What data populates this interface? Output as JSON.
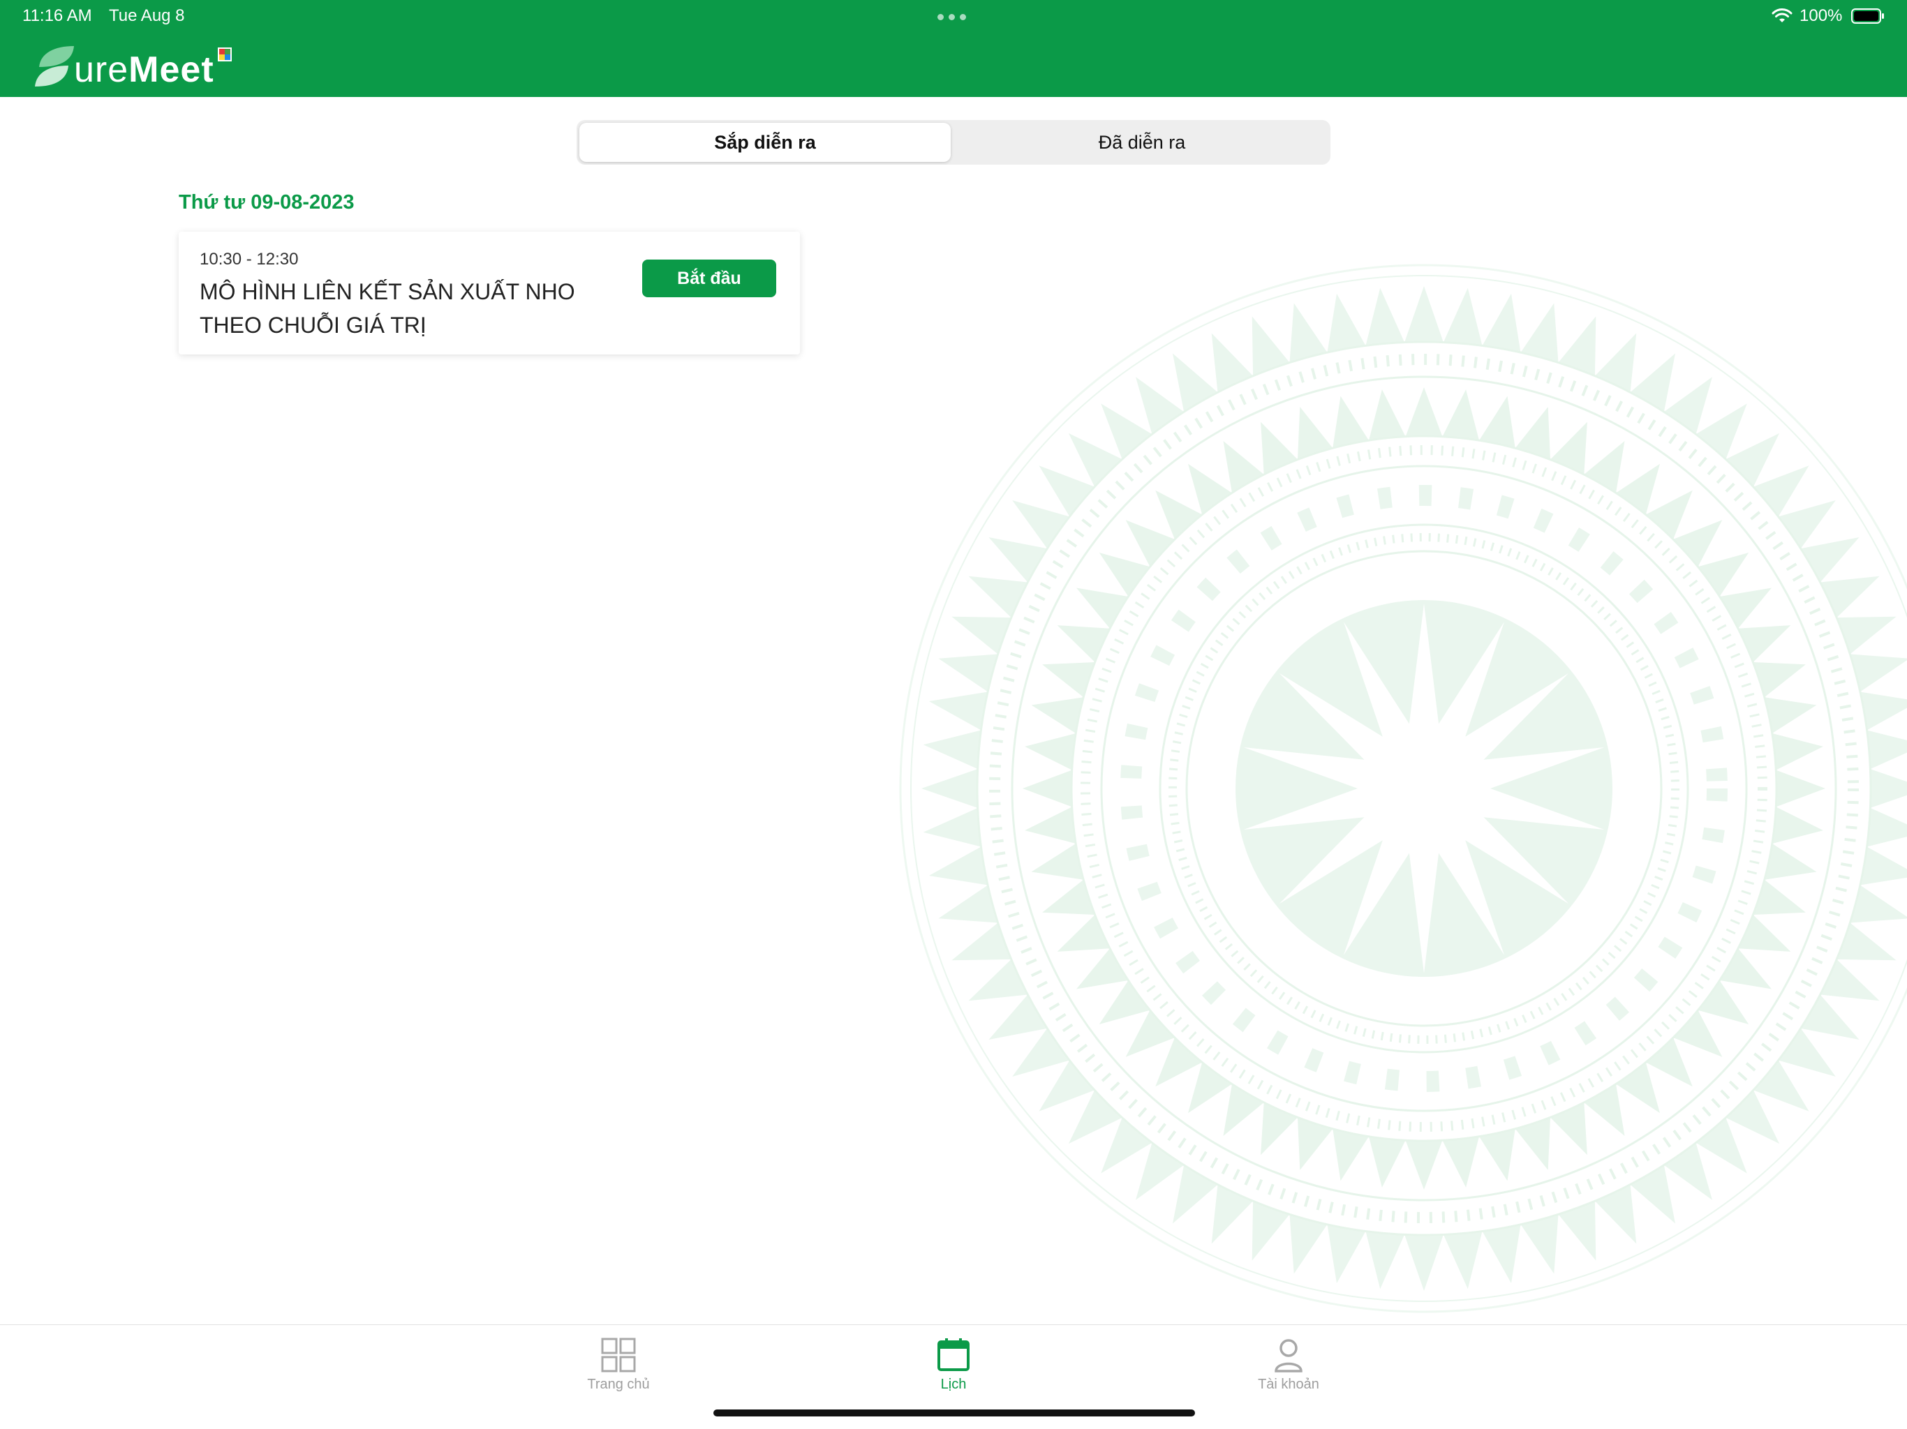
{
  "status_bar": {
    "time": "11:16 AM",
    "date": "Tue Aug 8",
    "battery": "100%"
  },
  "app": {
    "logo_text_thin": "ure",
    "logo_text_bold": "Meet",
    "brand_color": "#0b9a48"
  },
  "segments": {
    "upcoming": "Sắp diễn ra",
    "past": "Đã diễn ra",
    "selected": "upcoming"
  },
  "schedule": {
    "date_heading": "Thứ tư 09-08-2023",
    "meetings": [
      {
        "time": "10:30 - 12:30",
        "title": "MÔ HÌNH LIÊN KẾT SẢN XUẤT NHO THEO CHUỖI GIÁ TRỊ",
        "action": "Bắt đầu"
      }
    ]
  },
  "tabbar": {
    "items": [
      {
        "label": "Trang chủ",
        "icon": "grid-icon",
        "active": false
      },
      {
        "label": "Lịch",
        "icon": "calendar-icon",
        "active": true
      },
      {
        "label": "Tài khoản",
        "icon": "user-icon",
        "active": false
      }
    ]
  }
}
